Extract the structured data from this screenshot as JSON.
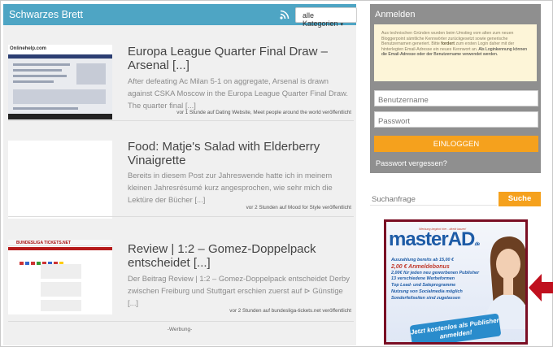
{
  "board": {
    "title": "Schwarzes Brett",
    "category_select": "alle Kategorien"
  },
  "posts": [
    {
      "title": "Europa League Quarter Final Draw – Arsenal [...]",
      "excerpt": "After defeating Ac Milan 5-1 on aggregate, Arsenal is drawn against CSKA Moscow in the Europa League Quarter Final Draw. The quarter final [...]",
      "meta": "vor 1 Stunde auf Dating Website, Meet people around the world veröffentlicht",
      "thumb_logo": "Onlinehelp.com"
    },
    {
      "title": "Food: Matje's Salad with Elderberry Vinaigrette",
      "excerpt": "Bereits in diesem Post zur Jahreswende hatte ich in meinem kleinen Jahresrésumé kurz angesprochen, wie sehr mich die Lektüre der Bücher [...]",
      "meta": "vor 2 Stunden auf Mood for Style veröffentlicht"
    },
    {
      "title": "Review | 1:2 – Gomez-Doppelpack entscheidet [...]",
      "excerpt": "Der Beitrag Review | 1:2 – Gomez-Doppelpack entscheidet Derby zwischen Freiburg und Stuttgart erschien zuerst auf ⊳ Günstige [...]",
      "meta": "vor 2 Stunden auf bundesliga-tickets.net veröffentlicht",
      "thumb_logo": "BUNDESLIGA TICKETS.NET"
    }
  ],
  "werbung": "-Werbung-",
  "login": {
    "title": "Anmelden",
    "note_part1": "Aus technischen Gründen wurden beim Umstieg vom alten zum neuen Bloggerpoint sämtliche Kennwörter zurückgesetzt sowie generische Benutzernamen generiert. Bitte",
    "note_bold": "fordert",
    "note_part2": "zum ersten Login daher mit der hinterlegten Email-Adresse ein neues Kennwort an.",
    "note_dark": "Als Loginkennung können die Email-Adresse oder der Benutzername verwendet werden.",
    "username_placeholder": "Benutzername",
    "password_placeholder": "Passwort",
    "submit_label": "EINLOGGEN",
    "forgot_label": "Passwort vergessen?"
  },
  "search": {
    "placeholder": "Suchanfrage",
    "button_label": "Suche"
  },
  "ad": {
    "logo": "masterAD",
    "logo_suffix": ".de",
    "tagline": "Werbung beginnt hier - direkt bauen!",
    "items": [
      "Auszahlung bereits ab 15,00 €",
      "2,00 € Anmeldebonus",
      "2,00€ für jeden neu geworbenen Publisher",
      "13 verschiedene Werbeformen",
      "Top Lead- und Saleprogramme",
      "Nutzung von Socialmedia möglich",
      "Sonderfeilseiten sind zugelassen"
    ],
    "cta": "Jetzt kostenlos als Publisher anmelden!",
    "colors": {
      "frame": "#7a0e24",
      "brand": "#1d5ba6",
      "arrow": "#c0101e"
    }
  },
  "colors": {
    "header": "#4ea5c4",
    "accent": "#f5a11d",
    "login_bg": "#8f8f8f"
  }
}
